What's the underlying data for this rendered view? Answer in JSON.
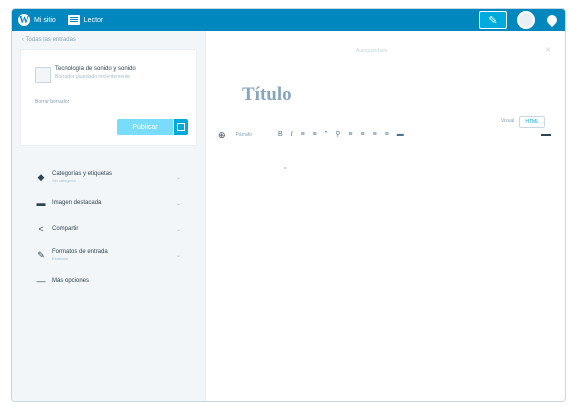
{
  "masterbar": {
    "my_sites_label": "Mi sitio",
    "reader_label": "Lector",
    "write_icon": "pencil-icon",
    "notifications_icon": "bell-icon"
  },
  "sidebar": {
    "back_label": "‹ Todas las entradas",
    "draft": {
      "title": "Tecnología de sonido y sonido",
      "subtitle": "Borrador guardado recientemente",
      "link": "Borrar borrador"
    },
    "publish_label": "Publicar",
    "items": [
      {
        "label": "Categorías y etiquetas",
        "sub": "Sin categoría",
        "icon": "folder-icon"
      },
      {
        "label": "Imagen destacada",
        "sub": "",
        "icon": "image-icon"
      },
      {
        "label": "Compartir",
        "sub": "",
        "icon": "share-icon"
      },
      {
        "label": "Formatos de entrada",
        "sub": "Estándar",
        "icon": "format-icon"
      },
      {
        "label": "Más opciones",
        "sub": "",
        "icon": "minus-icon"
      }
    ]
  },
  "editor": {
    "status": "Autoguardado",
    "title_placeholder": "Título",
    "tabs": [
      "Visual",
      "HTML"
    ],
    "format_label": "Párrafo",
    "toolbar_icons": [
      "bold-icon",
      "italic-icon",
      "bullet-list-icon",
      "numbered-list-icon",
      "quote-icon",
      "link-icon",
      "align-left-icon",
      "align-center-icon",
      "align-right-icon",
      "strikethrough-icon",
      "more-icon"
    ]
  },
  "colors": {
    "masterbar": "#0087be",
    "accent": "#00aadc",
    "publish": "#78dcfa"
  }
}
